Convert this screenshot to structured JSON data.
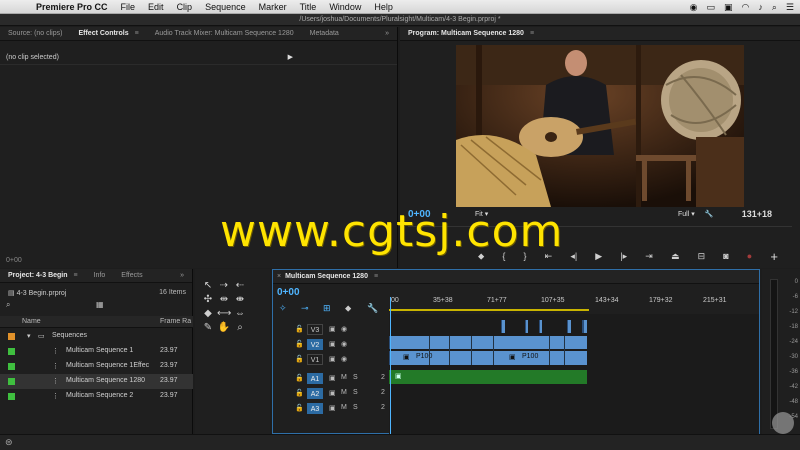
{
  "menubar": {
    "app_name": "Premiere Pro CC",
    "items": [
      "File",
      "Edit",
      "Clip",
      "Sequence",
      "Marker",
      "Title",
      "Window",
      "Help"
    ]
  },
  "window_title": "/Users/joshua/Documents/Pluralsight/Multicam/4-3 Begin.prproj *",
  "source_panel": {
    "tabs": [
      "Source: (no clips)",
      "Effect Controls",
      "Audio Track Mixer: Multicam Sequence 1280",
      "Metadata"
    ],
    "active_tab": "Effect Controls",
    "no_clip_text": "(no clip selected)",
    "timecode": "0+00"
  },
  "program_panel": {
    "title": "Program: Multicam Sequence 1280",
    "timecode": "0+00",
    "fit": "Fit",
    "resolution": "Full",
    "duration": "131+18"
  },
  "project_panel": {
    "tabs": [
      "Project: 4-3 Begin",
      "Info",
      "Effects"
    ],
    "file": "4-3 Begin.prproj",
    "items_count": "16 Items",
    "columns": {
      "name": "Name",
      "frame_rate": "Frame Ra"
    },
    "rows": [
      {
        "label": "Sequences",
        "frame": "",
        "color": "#e0912a",
        "type": "folder"
      },
      {
        "label": "Multicam Sequence 1",
        "frame": "23.97",
        "color": "#3fbf3f",
        "type": "seq"
      },
      {
        "label": "Multicam Sequence 1Effec",
        "frame": "23.97",
        "color": "#3fbf3f",
        "type": "seq"
      },
      {
        "label": "Multicam Sequence 1280",
        "frame": "23.97",
        "color": "#3fbf3f",
        "type": "seq"
      },
      {
        "label": "Multicam Sequence 2",
        "frame": "23.97",
        "color": "#3fbf3f",
        "type": "seq"
      }
    ]
  },
  "timeline": {
    "tab": "Multicam Sequence 1280",
    "timecode": "0+00",
    "ruler": [
      "00",
      "35+38",
      "71+77",
      "107+35",
      "143+34",
      "179+32",
      "215+31"
    ],
    "tracks": [
      {
        "name": "V3",
        "type": "video"
      },
      {
        "name": "V2",
        "type": "video"
      },
      {
        "name": "V1",
        "type": "video"
      },
      {
        "name": "A1",
        "type": "audio"
      },
      {
        "name": "A2",
        "type": "audio"
      },
      {
        "name": "A3",
        "type": "audio"
      }
    ],
    "clip_label": "P100"
  },
  "meter_levels": [
    "0",
    "-6",
    "-12",
    "-18",
    "-24",
    "-30",
    "-36",
    "-42",
    "-48",
    "-54"
  ],
  "watermark": "www.cgtsj.com"
}
